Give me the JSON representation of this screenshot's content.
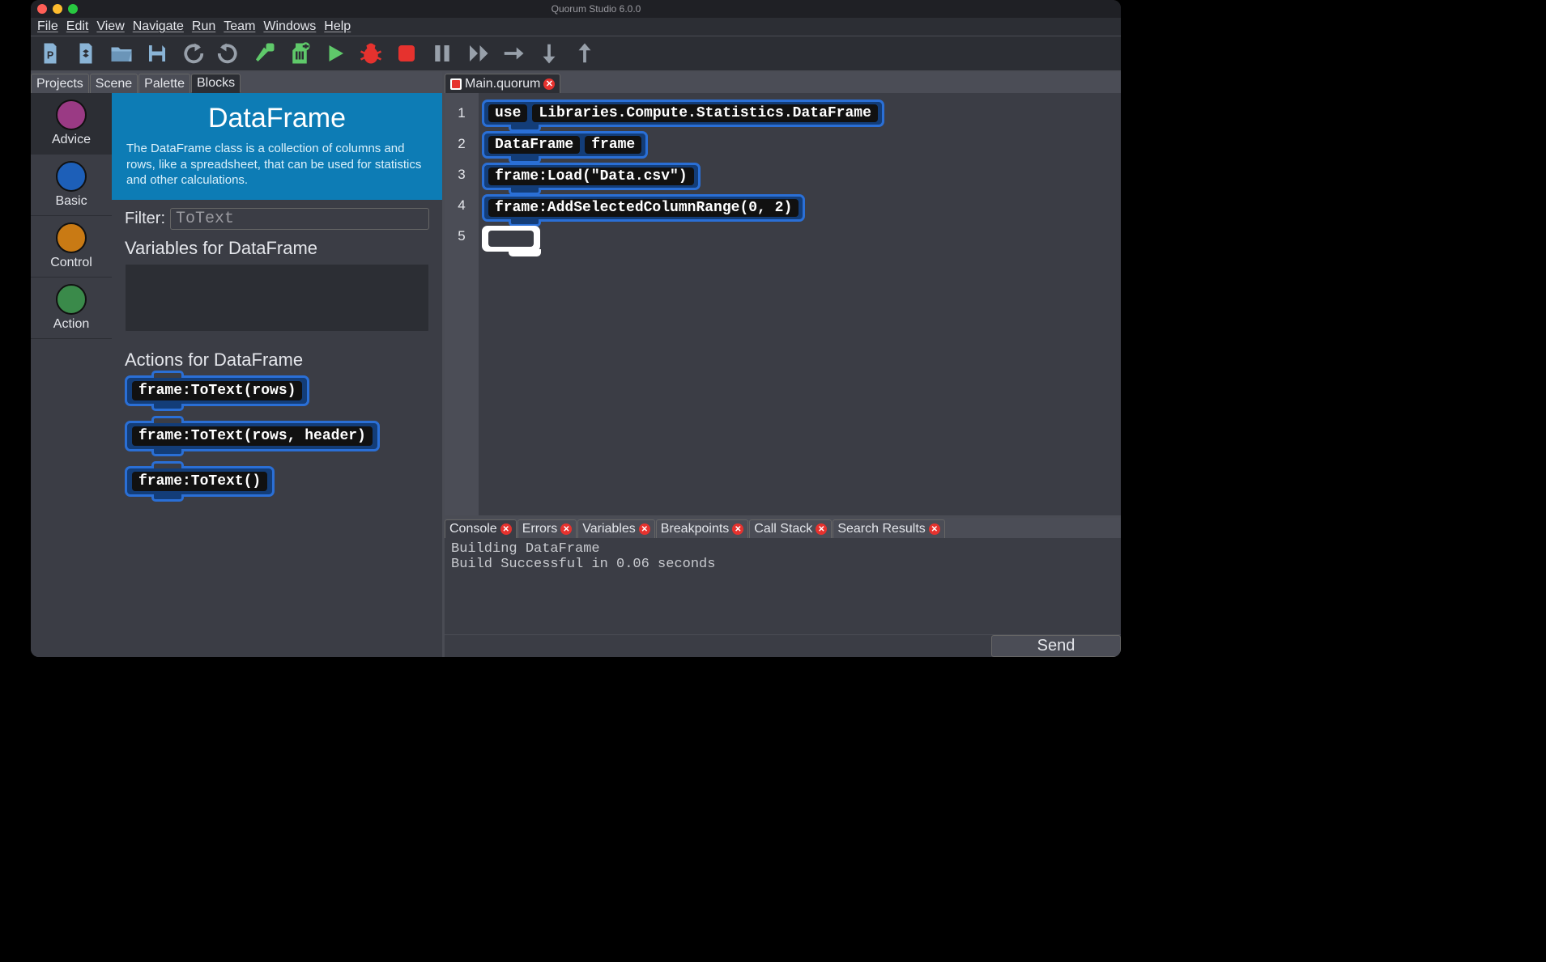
{
  "window": {
    "title": "Quorum Studio 6.0.0"
  },
  "menu": {
    "items": [
      "File",
      "Edit",
      "View",
      "Navigate",
      "Run",
      "Team",
      "Windows",
      "Help"
    ]
  },
  "toolbar_icons": [
    "new-project-icon",
    "new-file-icon",
    "open-icon",
    "save-icon",
    "undo-icon",
    "redo-icon",
    "build-icon",
    "clean-build-icon",
    "run-icon",
    "debug-icon",
    "stop-icon",
    "pause-icon",
    "step-icon",
    "step-over-icon",
    "step-into-icon",
    "step-out-icon"
  ],
  "left_tabs": {
    "items": [
      "Projects",
      "Scene",
      "Palette",
      "Blocks"
    ],
    "active": "Blocks"
  },
  "categories": [
    {
      "name": "Advice",
      "color": "#9a3a84",
      "active": true
    },
    {
      "name": "Basic",
      "color": "#1d5fb8",
      "active": false
    },
    {
      "name": "Control",
      "color": "#c97a14",
      "active": false
    },
    {
      "name": "Action",
      "color": "#3a8a4a",
      "active": false
    }
  ],
  "detail": {
    "title": "DataFrame",
    "description": "The DataFrame class is a collection of columns and rows, like a spreadsheet,  that can be used for statistics and other calculations.",
    "filter_label": "Filter:",
    "filter_value": "ToText",
    "variables_heading": "Variables for DataFrame",
    "actions_heading": "Actions for DataFrame",
    "actions": [
      "frame:ToText(rows)",
      "frame:ToText(rows, header)",
      "frame:ToText()"
    ]
  },
  "editor": {
    "tab": {
      "filename": "Main.quorum"
    },
    "line_numbers": [
      "1",
      "2",
      "3",
      "4",
      "5"
    ],
    "lines": [
      {
        "type": "use",
        "segments": [
          "use",
          "Libraries.Compute.Statistics.DataFrame"
        ]
      },
      {
        "type": "decl",
        "segments": [
          "DataFrame",
          "frame"
        ]
      },
      {
        "type": "call",
        "segments": [
          "frame:Load(\"Data.csv\")"
        ]
      },
      {
        "type": "call",
        "segments": [
          "frame:AddSelectedColumnRange(0, 2)"
        ]
      },
      {
        "type": "cursor",
        "segments": []
      }
    ]
  },
  "bottom": {
    "tabs": [
      "Console",
      "Errors",
      "Variables",
      "Breakpoints",
      "Call Stack",
      "Search Results"
    ],
    "active": "Console",
    "console_text": "Building DataFrame\nBuild Successful in 0.06 seconds",
    "send_label": "Send"
  }
}
